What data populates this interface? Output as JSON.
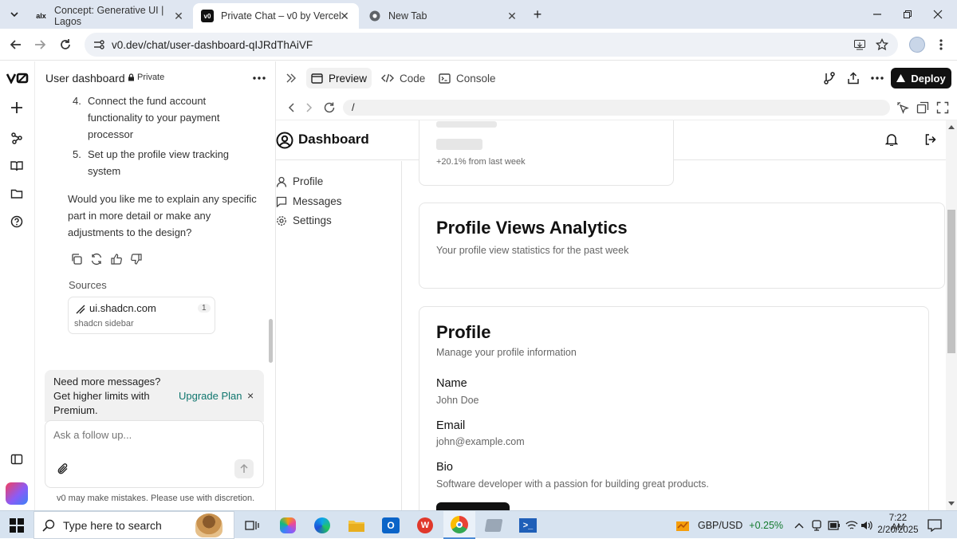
{
  "browser": {
    "tabs": [
      {
        "title": "Concept: Generative UI | Lagos",
        "icon": "alx-favicon"
      },
      {
        "title": "Private Chat – v0 by Vercel",
        "icon": "v0-favicon"
      },
      {
        "title": "New Tab",
        "icon": "chrome-favicon"
      }
    ],
    "url": "v0.dev/chat/user-dashboard-qIJRdThAiVF"
  },
  "chat": {
    "title": "User dashboard",
    "privacy": "Private",
    "steps": [
      {
        "num": "4.",
        "text_lines": [
          "Connect the fund account",
          "functionality to your payment",
          "processor"
        ]
      },
      {
        "num": "5.",
        "text_lines": [
          "Set up the profile view tracking",
          "system"
        ]
      }
    ],
    "question_lines": [
      "Would you like me to explain any specific",
      "part in more detail or make any",
      "adjustments to the design?"
    ],
    "sources_label": "Sources",
    "source": {
      "title": "ui.shadcn.com",
      "count": "1",
      "subtitle": "shadcn sidebar"
    },
    "upgrade": {
      "lines": [
        "Need more messages?",
        "Get higher limits with",
        "Premium."
      ],
      "link": "Upgrade Plan",
      "close": "×"
    },
    "input_placeholder": "Ask a follow up...",
    "disclaimer": "v0 may make mistakes. Please use with discretion."
  },
  "preview_toolbar": {
    "tabs": [
      "Preview",
      "Code",
      "Console"
    ],
    "deploy": "Deploy",
    "path": "/"
  },
  "app": {
    "title": "Dashboard",
    "nav": [
      "Profile",
      "Messages",
      "Settings"
    ],
    "stat_change": "+20.1% from last week",
    "analytics": {
      "title": "Profile Views Analytics",
      "subtitle": "Your profile view statistics for the past week"
    },
    "profile": {
      "title": "Profile",
      "subtitle": "Manage your profile information",
      "fields": [
        {
          "label": "Name",
          "value": "John Doe"
        },
        {
          "label": "Email",
          "value": "john@example.com"
        },
        {
          "label": "Bio",
          "value": "Software developer with a passion for building great products."
        }
      ]
    }
  },
  "taskbar": {
    "search_placeholder": "Type here to search",
    "ticker": {
      "label": "GBP/USD",
      "change": "+0.25%"
    },
    "time": "7:22 AM",
    "date": "2/20/2025"
  },
  "colors": {
    "accent_link": "#0f766e",
    "ticker_up": "#137a2e",
    "deploy_bg": "#111111"
  }
}
